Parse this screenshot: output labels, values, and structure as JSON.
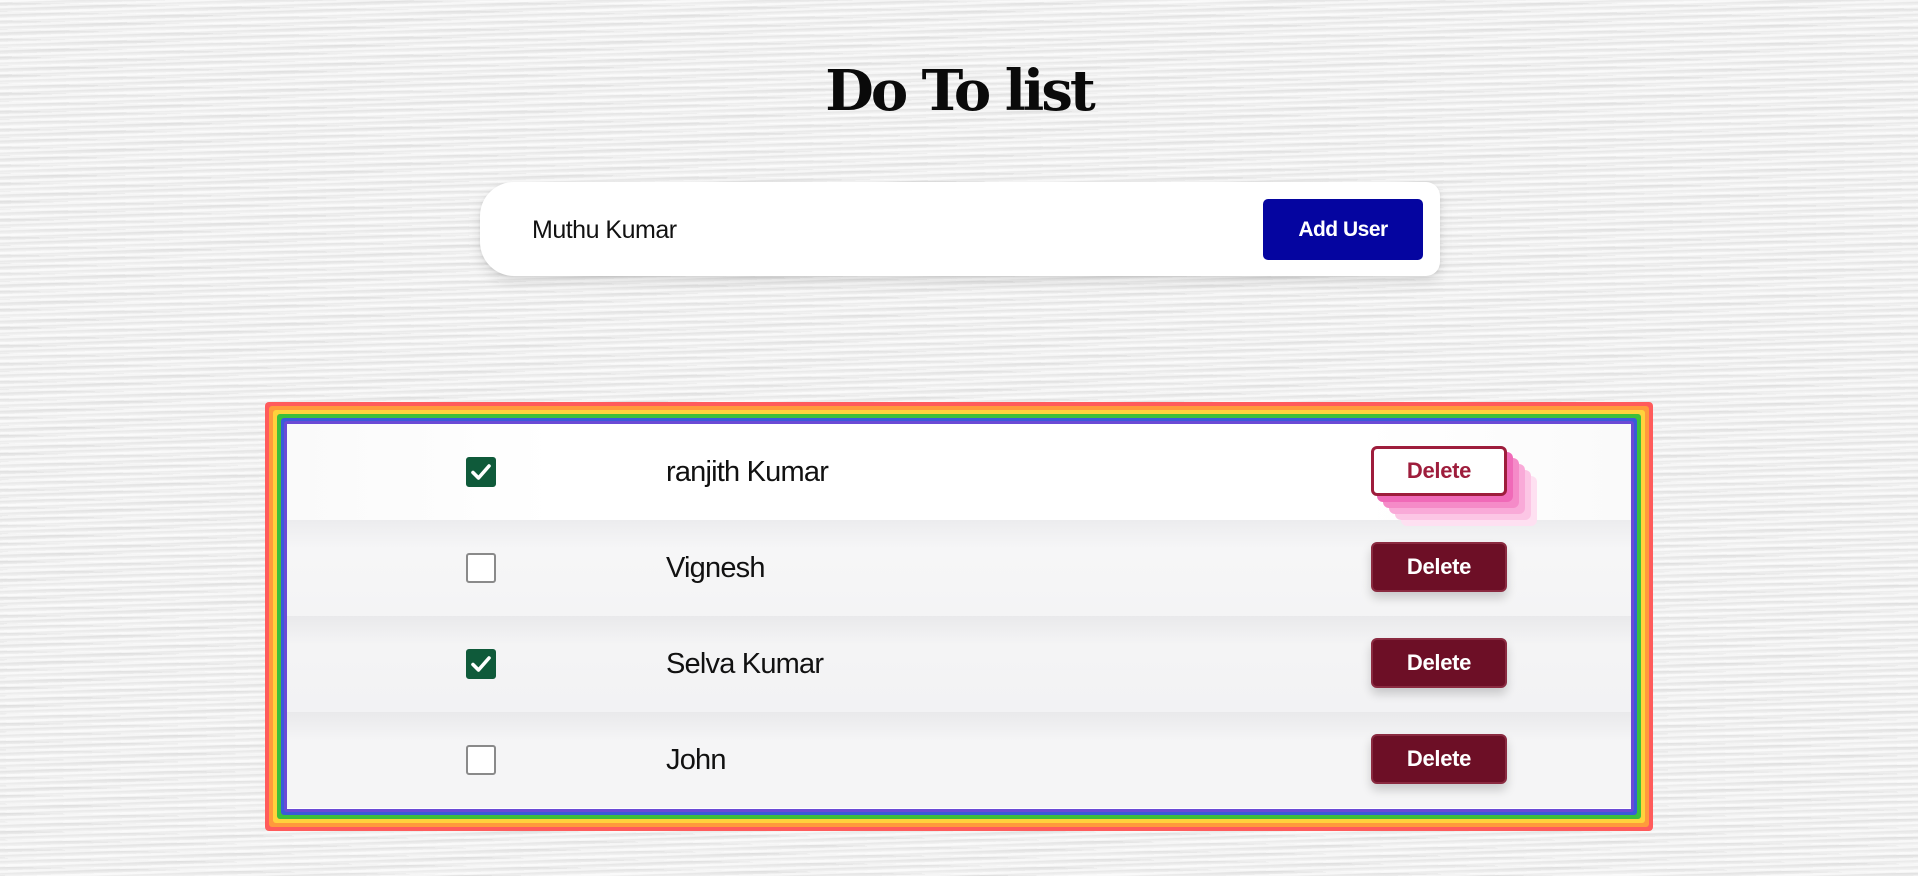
{
  "page": {
    "title": "Do To list"
  },
  "add_form": {
    "input_value": "Muthu Kumar",
    "button_label": "Add User"
  },
  "users": [
    {
      "name": "ranjith Kumar",
      "checked": true,
      "delete_label": "Delete",
      "delete_style": "outline"
    },
    {
      "name": "Vignesh",
      "checked": false,
      "delete_label": "Delete",
      "delete_style": "filled"
    },
    {
      "name": "Selva Kumar",
      "checked": true,
      "delete_label": "Delete",
      "delete_style": "filled"
    },
    {
      "name": "John",
      "checked": false,
      "delete_label": "Delete",
      "delete_style": "filled"
    }
  ],
  "colors": {
    "add_button": "#0505a0",
    "delete_button": "#6d0f26",
    "checkbox_checked": "#0f5a3a",
    "frame_rainbow": [
      "#ff5b5b",
      "#ff9a3c",
      "#ffd23c",
      "#3cbf3c",
      "#3a5bd9",
      "#6b4ad6"
    ]
  },
  "icons": {
    "checkbox_checked": "check-icon"
  }
}
